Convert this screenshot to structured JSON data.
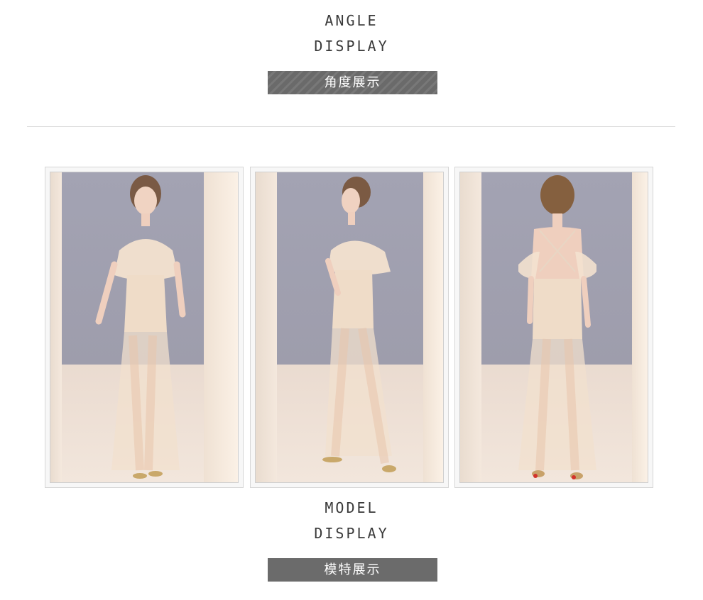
{
  "angle_section": {
    "title_line1": "ANGLE",
    "title_line2": "DISPLAY",
    "banner": "角度展示"
  },
  "model_section": {
    "title_line1": "MODEL",
    "title_line2": "DISPLAY",
    "banner": "模特展示"
  },
  "photos": [
    {
      "name": "front-view"
    },
    {
      "name": "side-view"
    },
    {
      "name": "back-view"
    }
  ],
  "colors": {
    "banner": "#6b6b6b",
    "heading": "#3a3a3a",
    "backdrop": "#a0a0b0",
    "dress": "#efd9c2"
  }
}
